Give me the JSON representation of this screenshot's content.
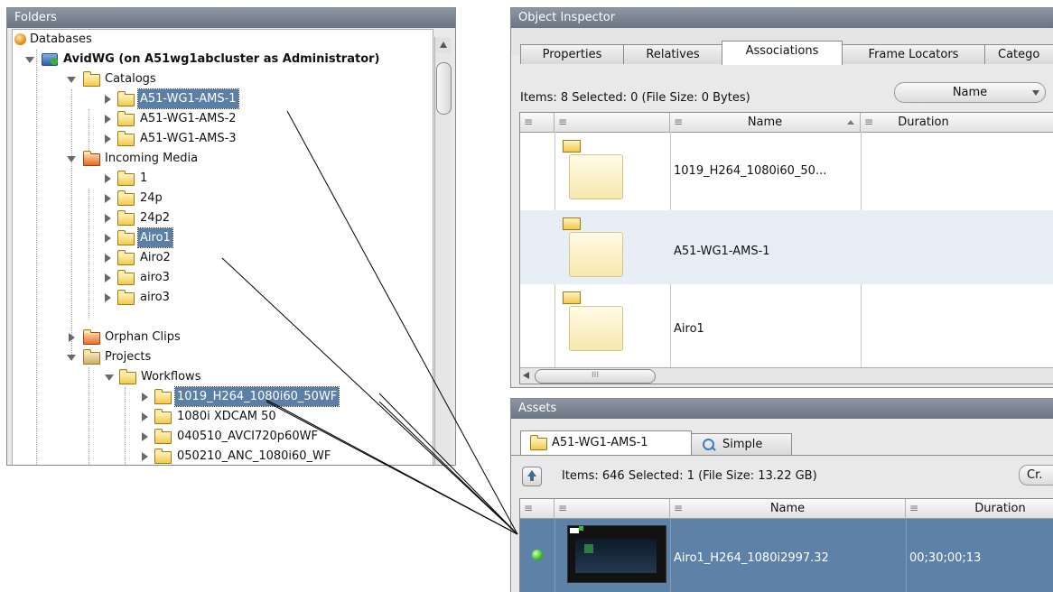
{
  "folders": {
    "title": "Folders",
    "root": "Databases",
    "db": "AvidWG (on A51wg1abcluster as Administrator)",
    "catalogs": "Catalogs",
    "catalog_items": [
      "A51-WG1-AMS-1",
      "A51-WG1-AMS-2",
      "A51-WG1-AMS-3"
    ],
    "incoming": "Incoming Media",
    "incoming_items": [
      "1",
      "24p",
      "24p2",
      "Airo1",
      "Airo2",
      "airo3",
      "airo3"
    ],
    "orphan": "Orphan Clips",
    "projects": "Projects",
    "workflows": "Workflows",
    "workflow_items": [
      "1019_H264_1080i60_50WF",
      "1080i XDCAM 50",
      "040510_AVCI720p60WF",
      "050210_ANC_1080i60_WF"
    ]
  },
  "inspector": {
    "title": "Object Inspector",
    "tabs": [
      "Properties",
      "Relatives",
      "Associations",
      "Frame Locators",
      "Catego"
    ],
    "items_info": "Items: 8 Selected: 0 (File Size: 0 Bytes)",
    "sort_value": "Name",
    "columns": [
      "",
      "",
      "Name",
      "Duration"
    ],
    "rows": [
      {
        "name": "1019_H264_1080i60_50..."
      },
      {
        "name": "A51-WG1-AMS-1"
      },
      {
        "name": "Airo1"
      }
    ],
    "scroll_grip": "III"
  },
  "assets": {
    "title": "Assets",
    "tab_folder": "A51-WG1-AMS-1",
    "tab_search": "Simple",
    "items_info": "Items: 646 Selected: 1 (File Size: 13.22 GB)",
    "cr_label": "Cr.",
    "columns": [
      "Name",
      "Duration"
    ],
    "row": {
      "name": "Airo1_H264_1080i2997.32",
      "duration": "00;30;00;13"
    }
  }
}
